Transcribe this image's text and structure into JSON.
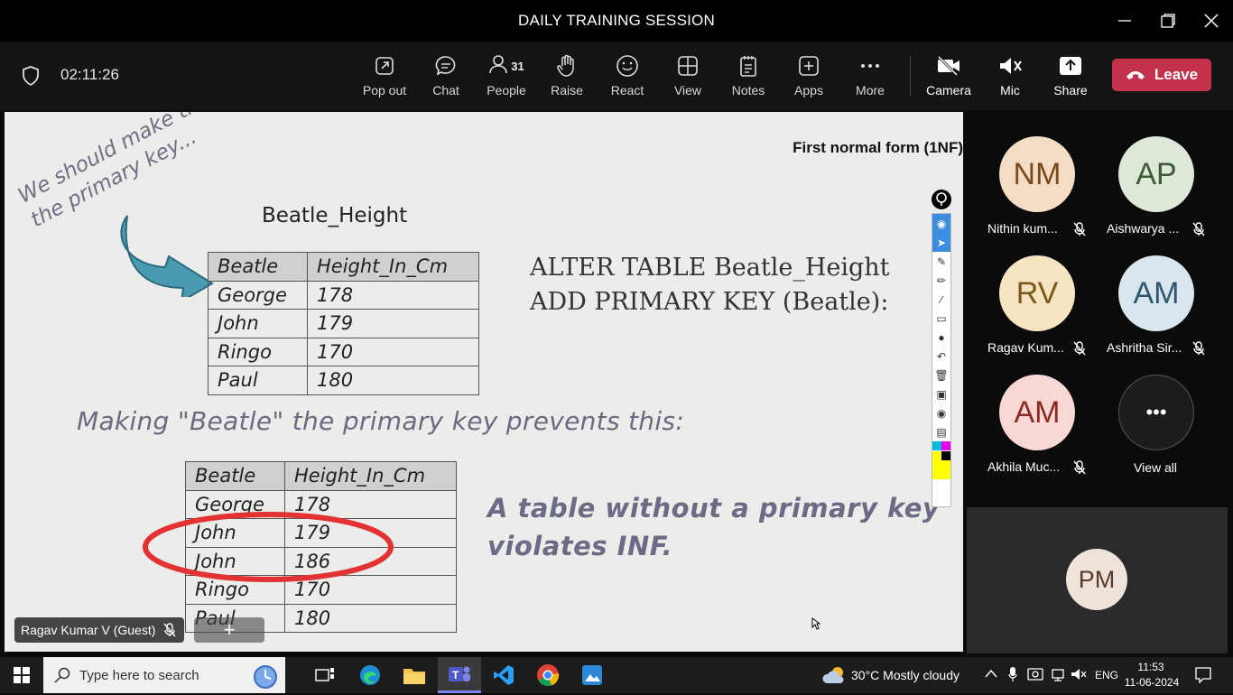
{
  "window": {
    "title": "DAILY TRAINING SESSION"
  },
  "toolbar": {
    "timer": "02:11:26",
    "buttons": [
      {
        "id": "popout",
        "label": "Pop out"
      },
      {
        "id": "chat",
        "label": "Chat"
      },
      {
        "id": "people",
        "label": "People",
        "count": "31"
      },
      {
        "id": "raise",
        "label": "Raise"
      },
      {
        "id": "react",
        "label": "React"
      },
      {
        "id": "view",
        "label": "View"
      },
      {
        "id": "notes",
        "label": "Notes"
      },
      {
        "id": "apps",
        "label": "Apps"
      },
      {
        "id": "more",
        "label": "More"
      },
      {
        "id": "camera",
        "label": "Camera"
      },
      {
        "id": "mic",
        "label": "Mic"
      },
      {
        "id": "share",
        "label": "Share"
      }
    ],
    "leave_label": "Leave",
    "leave_color": "#c4314b"
  },
  "slide": {
    "title": "First normal form (1NF)",
    "note": "We should make this\nthe primary key...",
    "table_title": "Beatle_Height",
    "table1": {
      "headers": [
        "Beatle",
        "Height_In_Cm"
      ],
      "rows": [
        [
          "George",
          "178"
        ],
        [
          "John",
          "179"
        ],
        [
          "Ringo",
          "170"
        ],
        [
          "Paul",
          "180"
        ]
      ]
    },
    "sql": [
      "ALTER TABLE Beatle_Height",
      "ADD PRIMARY KEY (Beatle):"
    ],
    "making": "Making \"Beatle\" the primary key prevents this:",
    "table2": {
      "headers": [
        "Beatle",
        "Height_In_Cm"
      ],
      "rows": [
        [
          "George",
          "178"
        ],
        [
          "John",
          "179"
        ],
        [
          "John",
          "186"
        ],
        [
          "Ringo",
          "170"
        ],
        [
          "Paul",
          "180"
        ]
      ]
    },
    "violates": [
      "A table without a primary key",
      "violates INF."
    ],
    "presenter": "Ragav Kumar V (Guest)"
  },
  "participants": [
    {
      "initials": "NM",
      "name": "Nithin kum...",
      "bg": "#f5dcc4",
      "fg": "#7a4a1e"
    },
    {
      "initials": "AP",
      "name": "Aishwarya ...",
      "bg": "#dde8d8",
      "fg": "#3d5a36"
    },
    {
      "initials": "RV",
      "name": "Ragav Kum...",
      "bg": "#f6e4c2",
      "fg": "#7a5a18"
    },
    {
      "initials": "AM",
      "name": "Ashritha Sir...",
      "bg": "#d9e6ee",
      "fg": "#2f5670"
    },
    {
      "initials": "AM",
      "name": "Akhila Muc...",
      "bg": "#f8d8d4",
      "fg": "#8a2a22"
    }
  ],
  "view_all": {
    "label": "View all",
    "glyph": "•••"
  },
  "pinned": {
    "initials": "PM"
  },
  "taskbar": {
    "search_placeholder": "Type here to search",
    "weather": "30°C  Mostly cloudy",
    "lang": "ENG",
    "time": "11:53",
    "date": "11-06-2024"
  }
}
